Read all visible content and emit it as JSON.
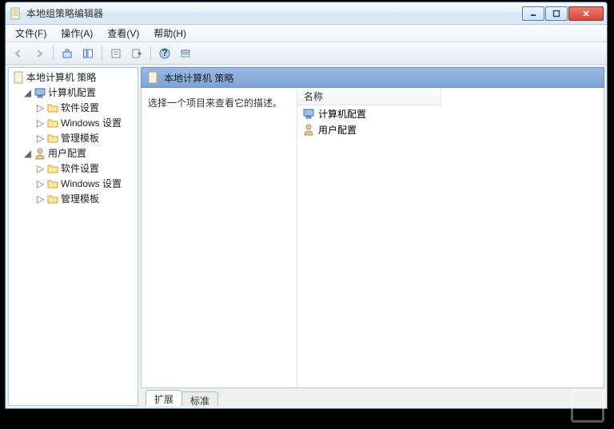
{
  "window": {
    "title": "本地组策略编辑器"
  },
  "menu": {
    "file": "文件(F)",
    "action": "操作(A)",
    "view": "查看(V)",
    "help": "帮助(H)"
  },
  "tree": {
    "root": "本地计算机 策略",
    "computer": {
      "label": "计算机配置",
      "software": "软件设置",
      "windows": "Windows 设置",
      "templates": "管理模板"
    },
    "user": {
      "label": "用户配置",
      "software": "软件设置",
      "windows": "Windows 设置",
      "templates": "管理模板"
    }
  },
  "detail": {
    "header": "本地计算机 策略",
    "prompt": "选择一个项目来查看它的描述。",
    "column_name": "名称",
    "items": {
      "computer": "计算机配置",
      "user": "用户配置"
    }
  },
  "tabs": {
    "extended": "扩展",
    "standard": "标准"
  }
}
